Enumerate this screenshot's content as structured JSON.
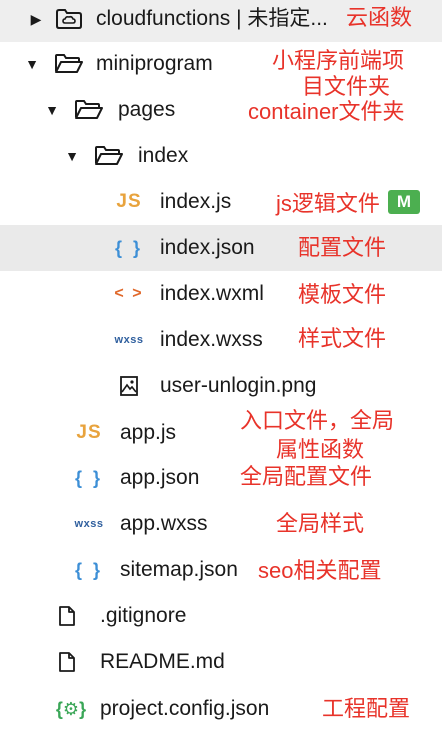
{
  "tree": {
    "cloudfunctions": "cloudfunctions | 未指定...",
    "miniprogram": "miniprogram",
    "pages": "pages",
    "index": "index",
    "index_js": "index.js",
    "index_json": "index.json",
    "index_wxml": "index.wxml",
    "index_wxss": "index.wxss",
    "user_unlogin": "user-unlogin.png",
    "app_js": "app.js",
    "app_json": "app.json",
    "app_wxss": "app.wxss",
    "sitemap_json": "sitemap.json",
    "gitignore": ".gitignore",
    "readme": "README.md",
    "project_config": "project.config.json"
  },
  "badges": {
    "index_js": "M"
  },
  "annotations": {
    "cloudfunctions": "云函数",
    "miniprogram_line1": "小程序前端项",
    "miniprogram_line2": "目文件夹",
    "pages": "container文件夹",
    "index_js": "js逻辑文件",
    "index_json": "配置文件",
    "index_wxml": "模板文件",
    "index_wxss": "样式文件",
    "app_js_line1": "入口文件，全局",
    "app_js_line2": "属性函数",
    "app_json": "全局配置文件",
    "app_wxss": "全局样式",
    "sitemap_json": "seo相关配置",
    "project_config": "工程配置"
  },
  "icons": {
    "expand": "chevron-right-icon",
    "collapse": "chevron-down-icon",
    "cloud_folder": "cloud-folder-icon",
    "folder": "folder-open-icon",
    "js": "JS",
    "json": "{ }",
    "wxml": "< >",
    "wxss": "wxss",
    "image": "image-icon",
    "file": "file-icon",
    "config": "{⚙}"
  },
  "colors": {
    "annotation": "#e8332a",
    "js_icon": "#e8a33d",
    "json_icon": "#3d8fd6",
    "wxml_icon": "#e0682a",
    "wxss_icon": "#2f5f9e",
    "config_icon": "#3aa657",
    "badge": "#4caf50"
  }
}
